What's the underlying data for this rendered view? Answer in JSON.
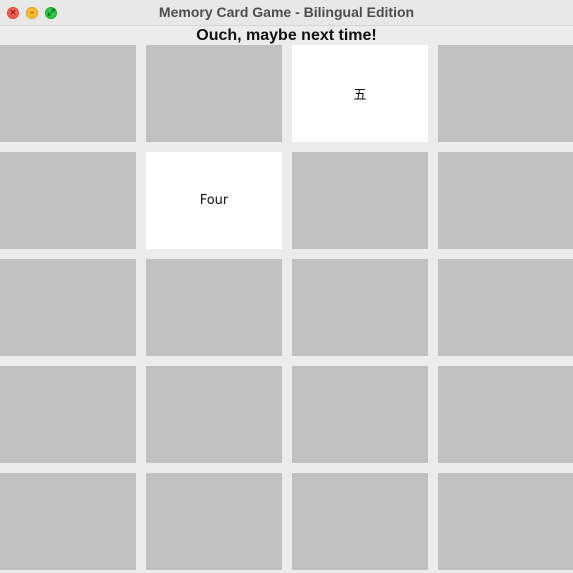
{
  "window": {
    "title": "Memory Card Game - Bilingual Edition",
    "controls": {
      "close_icon": "close-icon",
      "minimize_icon": "minimize-icon",
      "maximize_icon": "maximize-icon"
    }
  },
  "status": {
    "message": "Ouch, maybe next time!"
  },
  "colors": {
    "card_hidden": "#c0c0c0",
    "card_revealed": "#ffffff",
    "background": "#ececec"
  },
  "board": {
    "columns": 4,
    "rows": 5,
    "cards": [
      {
        "state": "hidden",
        "label": ""
      },
      {
        "state": "hidden",
        "label": ""
      },
      {
        "state": "revealed",
        "label": "五"
      },
      {
        "state": "hidden",
        "label": ""
      },
      {
        "state": "hidden",
        "label": ""
      },
      {
        "state": "revealed",
        "label": "Four"
      },
      {
        "state": "hidden",
        "label": ""
      },
      {
        "state": "hidden",
        "label": ""
      },
      {
        "state": "hidden",
        "label": ""
      },
      {
        "state": "hidden",
        "label": ""
      },
      {
        "state": "hidden",
        "label": ""
      },
      {
        "state": "hidden",
        "label": ""
      },
      {
        "state": "hidden",
        "label": ""
      },
      {
        "state": "hidden",
        "label": ""
      },
      {
        "state": "hidden",
        "label": ""
      },
      {
        "state": "hidden",
        "label": ""
      },
      {
        "state": "hidden",
        "label": ""
      },
      {
        "state": "hidden",
        "label": ""
      },
      {
        "state": "hidden",
        "label": ""
      },
      {
        "state": "hidden",
        "label": ""
      }
    ]
  }
}
